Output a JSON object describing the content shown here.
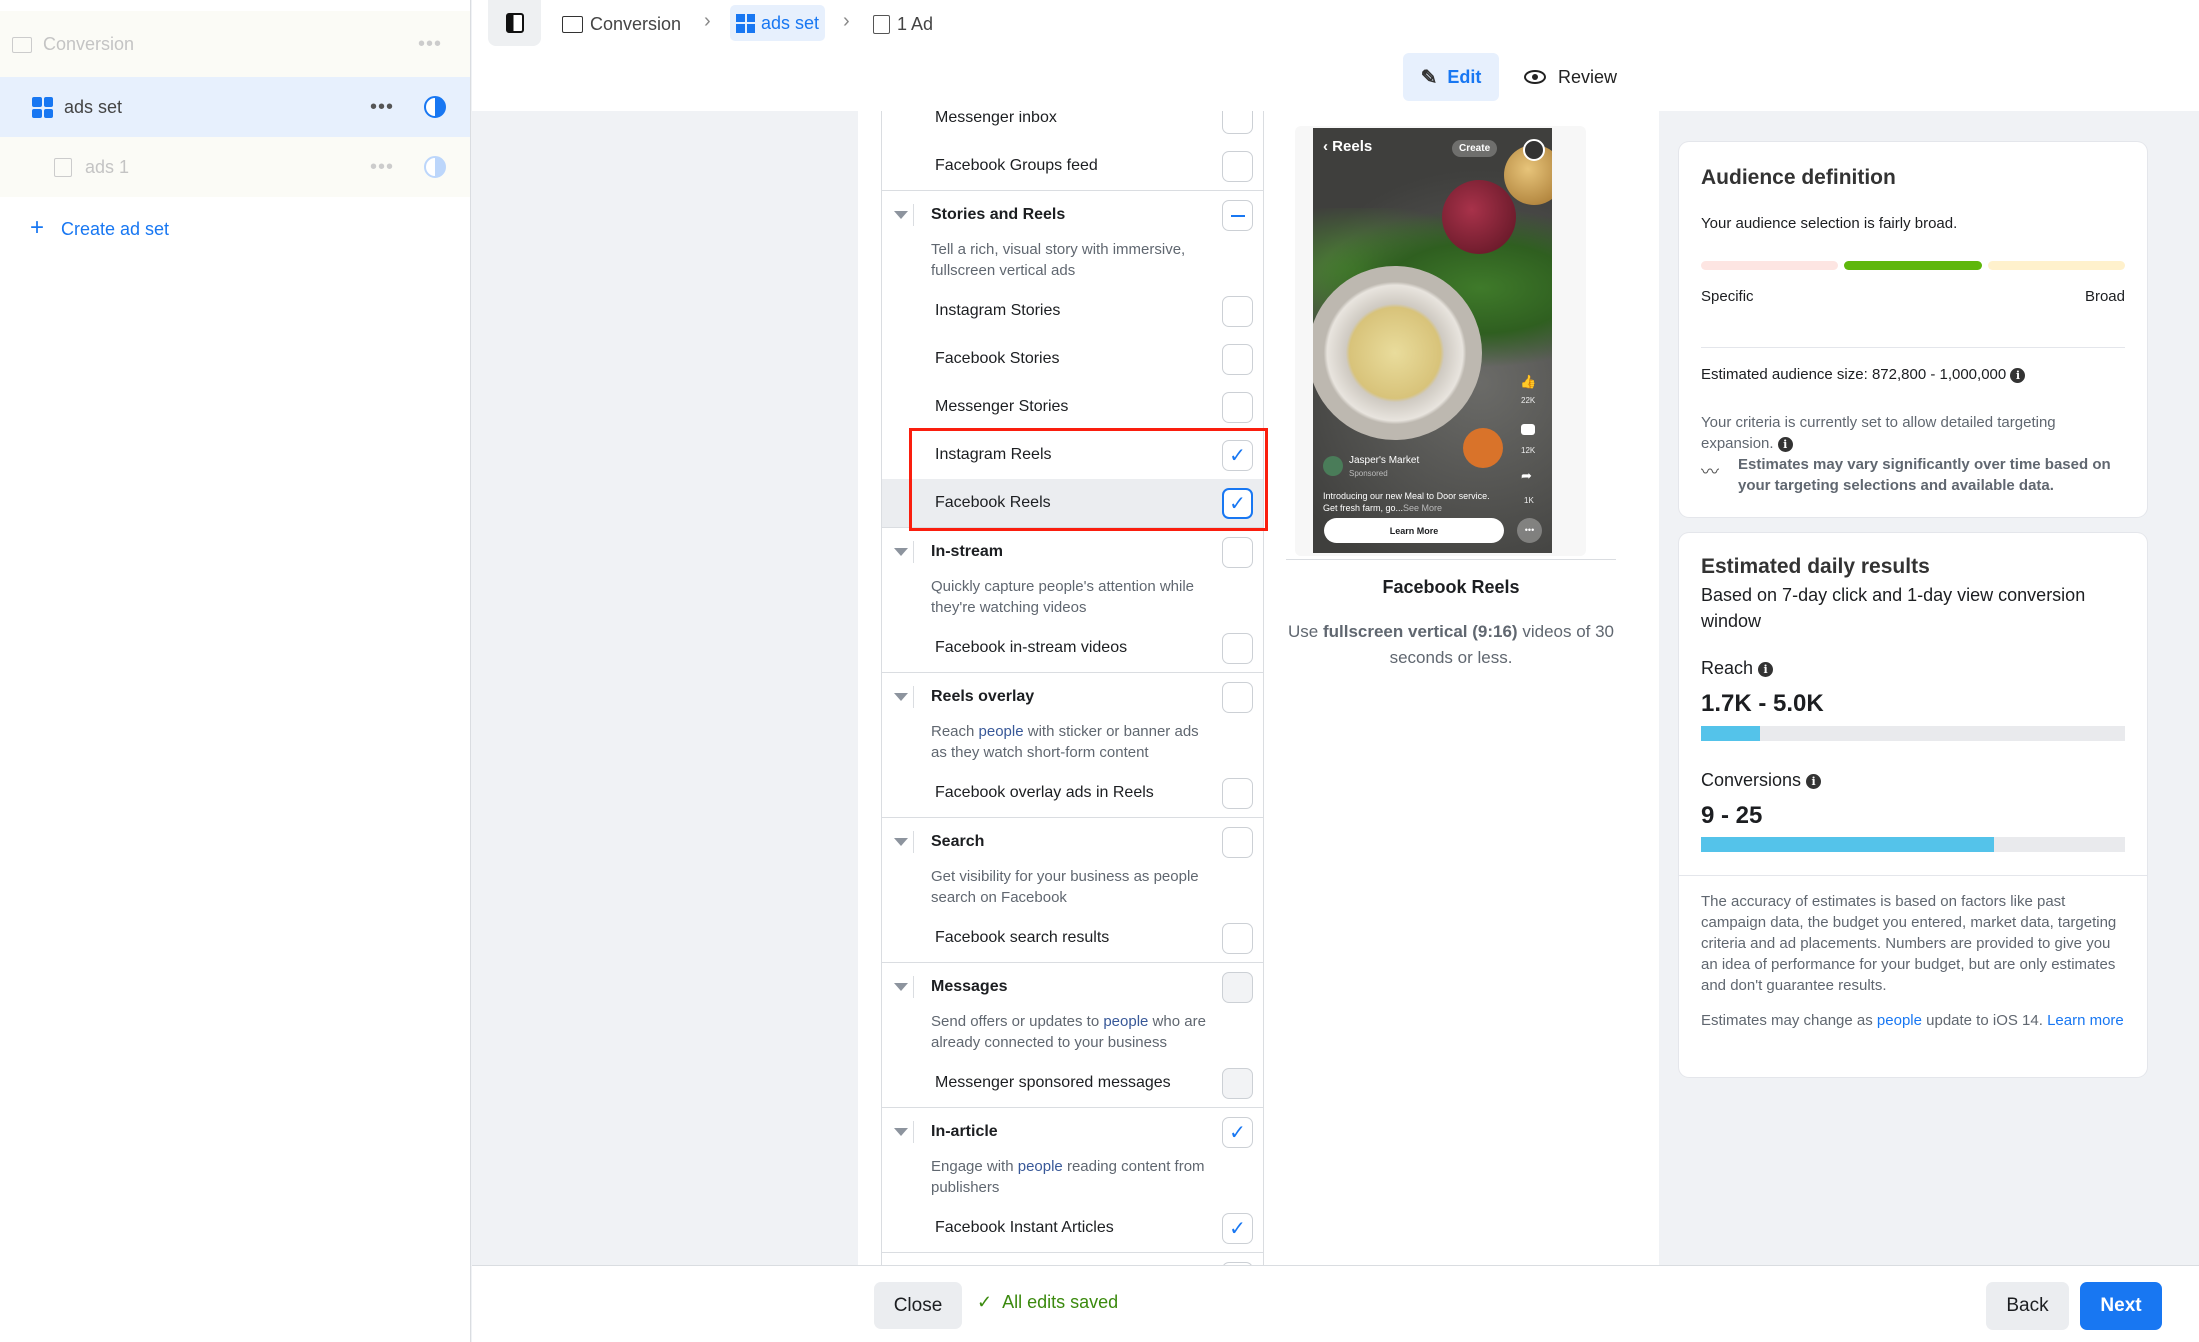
{
  "sidebar": {
    "items": [
      {
        "label": "Conversion",
        "icon": "folder-icon"
      },
      {
        "label": "ads set",
        "icon": "grid-icon"
      },
      {
        "label": "ads 1",
        "icon": "ad-icon"
      }
    ],
    "create_label": "Create ad set"
  },
  "breadcrumb": {
    "items": [
      "Conversion",
      "ads set",
      "1 Ad"
    ]
  },
  "mode_tabs": {
    "edit": "Edit",
    "review": "Review"
  },
  "placements": {
    "groups": [
      {
        "title": null,
        "state": null,
        "desc": [],
        "items": [
          {
            "label": "Messenger inbox",
            "state": "off"
          },
          {
            "label": "Facebook Groups feed",
            "state": "off"
          }
        ]
      },
      {
        "title": "Stories and Reels",
        "state": "mixed",
        "desc": [
          {
            "text": "Tell a rich, visual story with immersive, fullscreen vertical ads"
          }
        ],
        "items": [
          {
            "label": "Instagram Stories",
            "state": "off"
          },
          {
            "label": "Facebook Stories",
            "state": "off"
          },
          {
            "label": "Messenger Stories",
            "state": "off"
          },
          {
            "label": "Instagram Reels",
            "state": "on"
          },
          {
            "label": "Facebook Reels",
            "state": "on",
            "highlighted": true
          }
        ]
      },
      {
        "title": "In-stream",
        "state": "off",
        "desc": [
          {
            "text": "Quickly capture people's attention while they're watching videos"
          }
        ],
        "items": [
          {
            "label": "Facebook in-stream videos",
            "state": "off"
          }
        ]
      },
      {
        "title": "Reels overlay",
        "state": "off",
        "desc": [
          {
            "text": "Reach "
          },
          {
            "text": "people",
            "link": true
          },
          {
            "text": " with sticker or banner ads as they watch short-form content"
          }
        ],
        "items": [
          {
            "label": "Facebook overlay ads in Reels",
            "state": "off"
          }
        ]
      },
      {
        "title": "Search",
        "state": "off",
        "desc": [
          {
            "text": "Get visibility for your business as people search on Facebook"
          }
        ],
        "items": [
          {
            "label": "Facebook search results",
            "state": "off"
          }
        ]
      },
      {
        "title": "Messages",
        "state": "disabled",
        "desc": [
          {
            "text": "Send offers or updates to "
          },
          {
            "text": "people",
            "link": true
          },
          {
            "text": " who are already connected to your business"
          }
        ],
        "items": [
          {
            "label": "Messenger sponsored messages",
            "state": "disabled"
          }
        ]
      },
      {
        "title": "In-article",
        "state": "on",
        "desc": [
          {
            "text": "Engage with "
          },
          {
            "text": "people",
            "link": true
          },
          {
            "text": " reading content from publishers"
          }
        ],
        "items": [
          {
            "label": "Facebook Instant Articles",
            "state": "on"
          }
        ]
      }
    ]
  },
  "preview": {
    "phone": {
      "header": "Reels",
      "create": "Create",
      "likes": "22K",
      "comments": "12K",
      "shares": "1K",
      "advertiser": "Jasper's Market",
      "sponsored": "Sponsored",
      "caption": "Introducing our new Meal to Door service. Get fresh farm, go...",
      "see_more": "See More",
      "cta": "Learn More"
    },
    "title": "Facebook Reels",
    "desc_pre": "Use ",
    "desc_bold": "fullscreen vertical (9:16)",
    "desc_post": " videos of 30 seconds or less."
  },
  "audience": {
    "title": "Audience definition",
    "summary": "Your audience selection is fairly broad.",
    "meter_level": "middle",
    "colors": {
      "low": "#fde5e2",
      "mid": "#5fb70c",
      "high": "#fff1cc"
    },
    "specific": "Specific",
    "broad": "Broad",
    "size_label": "Estimated audience size:",
    "size_value": "872,800 - 1,000,000",
    "criteria": "Your criteria is currently set to allow detailed targeting expansion.",
    "variance": "Estimates may vary significantly over time based on your targeting selections and available data."
  },
  "daily": {
    "title": "Estimated daily results",
    "subtitle": "Based on 7-day click and 1-day view conversion window",
    "reach_label": "Reach",
    "reach_value": "1.7K - 5.0K",
    "reach_fill_percent": 14,
    "conv_label": "Conversions",
    "conv_value": "9 - 25",
    "conv_fill_percent": 69,
    "accuracy": "The accuracy of estimates is based on factors like past campaign data, the budget you entered, market data, targeting criteria and ad placements. Numbers are provided to give you an idea of performance for your budget, but are only estimates and don't guarantee results.",
    "ios_pre": "Estimates may change as ",
    "ios_link": "people",
    "ios_mid": " update to iOS 14. ",
    "learn_more": "Learn more"
  },
  "footer": {
    "close": "Close",
    "status": "All edits saved",
    "back": "Back",
    "next": "Next"
  }
}
